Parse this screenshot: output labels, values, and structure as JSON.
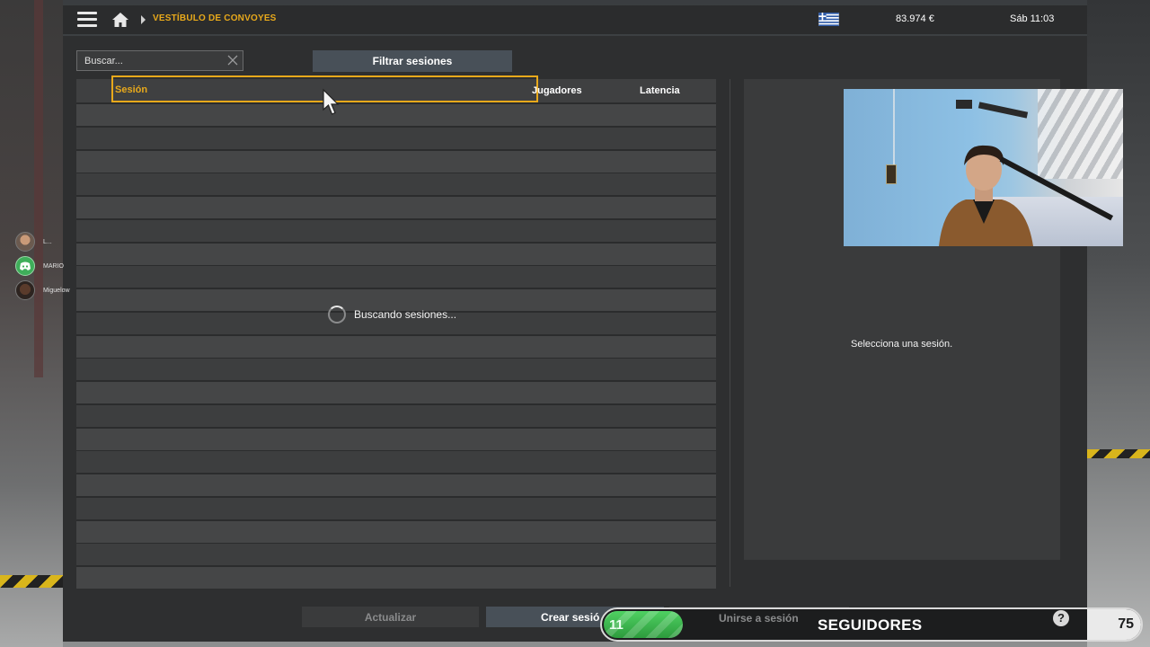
{
  "topbar": {
    "breadcrumb": "VESTÍBULO DE CONVOYES",
    "money": "83.974 €",
    "clock": "Sáb 11:03"
  },
  "search": {
    "placeholder": "Buscar..."
  },
  "filter_button": "Filtrar sesiones",
  "table": {
    "columns": [
      "Sesión",
      "Jugadores",
      "Latencia"
    ],
    "loading_text": "Buscando sesiones..."
  },
  "detail": {
    "empty_text": "Selecciona una sesión."
  },
  "friends": [
    {
      "name": "L..."
    },
    {
      "name": "MARIO"
    },
    {
      "name": "Miguelow"
    }
  ],
  "buttons": {
    "refresh": "Actualizar",
    "create": "Crear sesió",
    "join": "Unirse a sesión"
  },
  "followers_widget": {
    "current": "11",
    "label": "SEGUIDORES",
    "help": "?",
    "goal": "75",
    "progress": 0.147
  },
  "colors": {
    "accent": "#e8a91b",
    "panel": "#2e2f30",
    "button": "#485058",
    "progress": "#3fbf50"
  }
}
